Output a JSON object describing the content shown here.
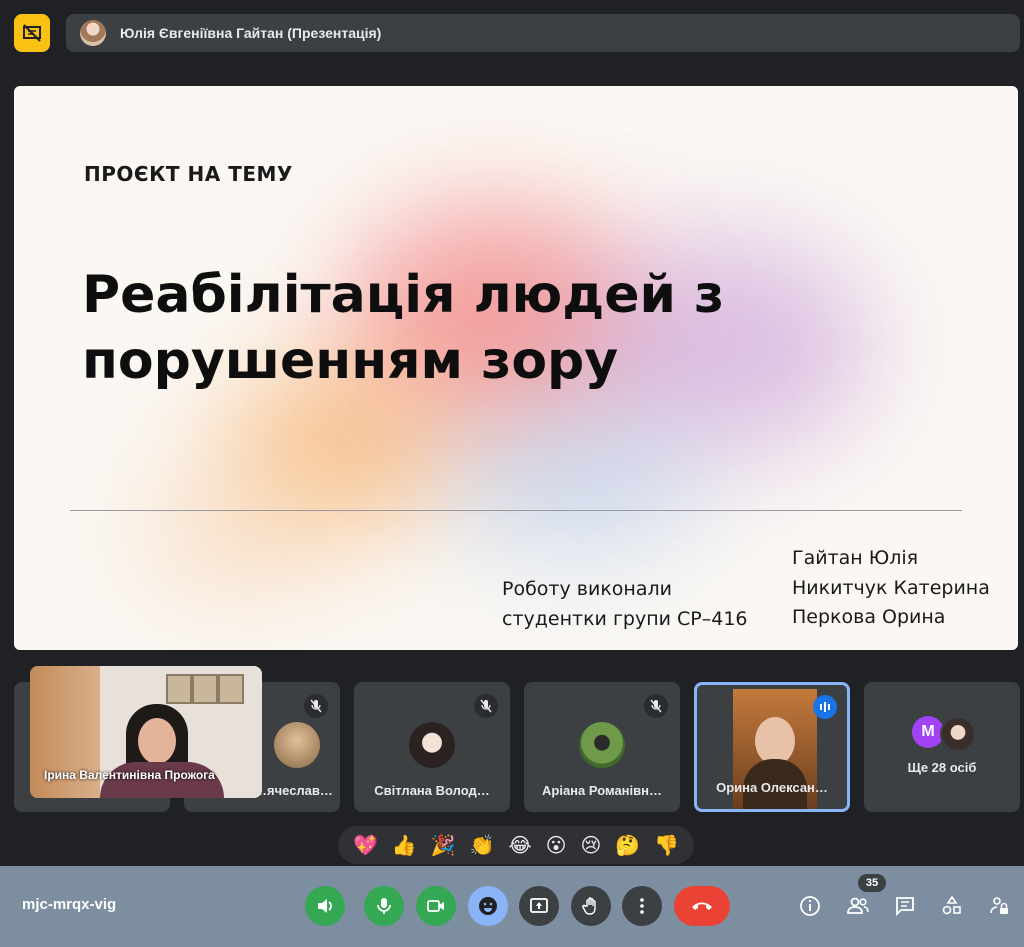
{
  "top": {
    "presenter_title": "Юлія Євгеніївна Гайтан (Презентація)",
    "present_icon": "presentation-off-icon"
  },
  "slide": {
    "eyebrow": "ПРОЄКТ НА ТЕМУ",
    "title": "Реабілітація людей з порушенням зору",
    "done_by_line1": "Роботу виконали",
    "done_by_line2": "студентки групи СР–416",
    "authors": [
      "Гайтан Юлія",
      "Никитчук Катерина",
      "Перкова Орина"
    ]
  },
  "participants": {
    "self_name": "Ірина Валентинівна Прожога",
    "tiles": [
      {
        "name": "…ячеслав…",
        "muted": true
      },
      {
        "name": "Світлана Волод…",
        "muted": true
      },
      {
        "name": "Аріана Романівн…",
        "muted": true
      },
      {
        "name": "Орина Олексан…",
        "speaking": true
      },
      {
        "name": "Ще 28 осіб",
        "avatar_letter": "M"
      }
    ]
  },
  "reactions": [
    "💖",
    "👍",
    "🎉",
    "👏",
    "😂",
    "😮",
    "😢",
    "🤔",
    "👎"
  ],
  "bottom": {
    "meeting_code": "mjc-mrqx-vig",
    "participants_count": "35",
    "accent_red": "#ea4335",
    "accent_green": "#34a853",
    "accent_blue": "#8ab4f8"
  }
}
